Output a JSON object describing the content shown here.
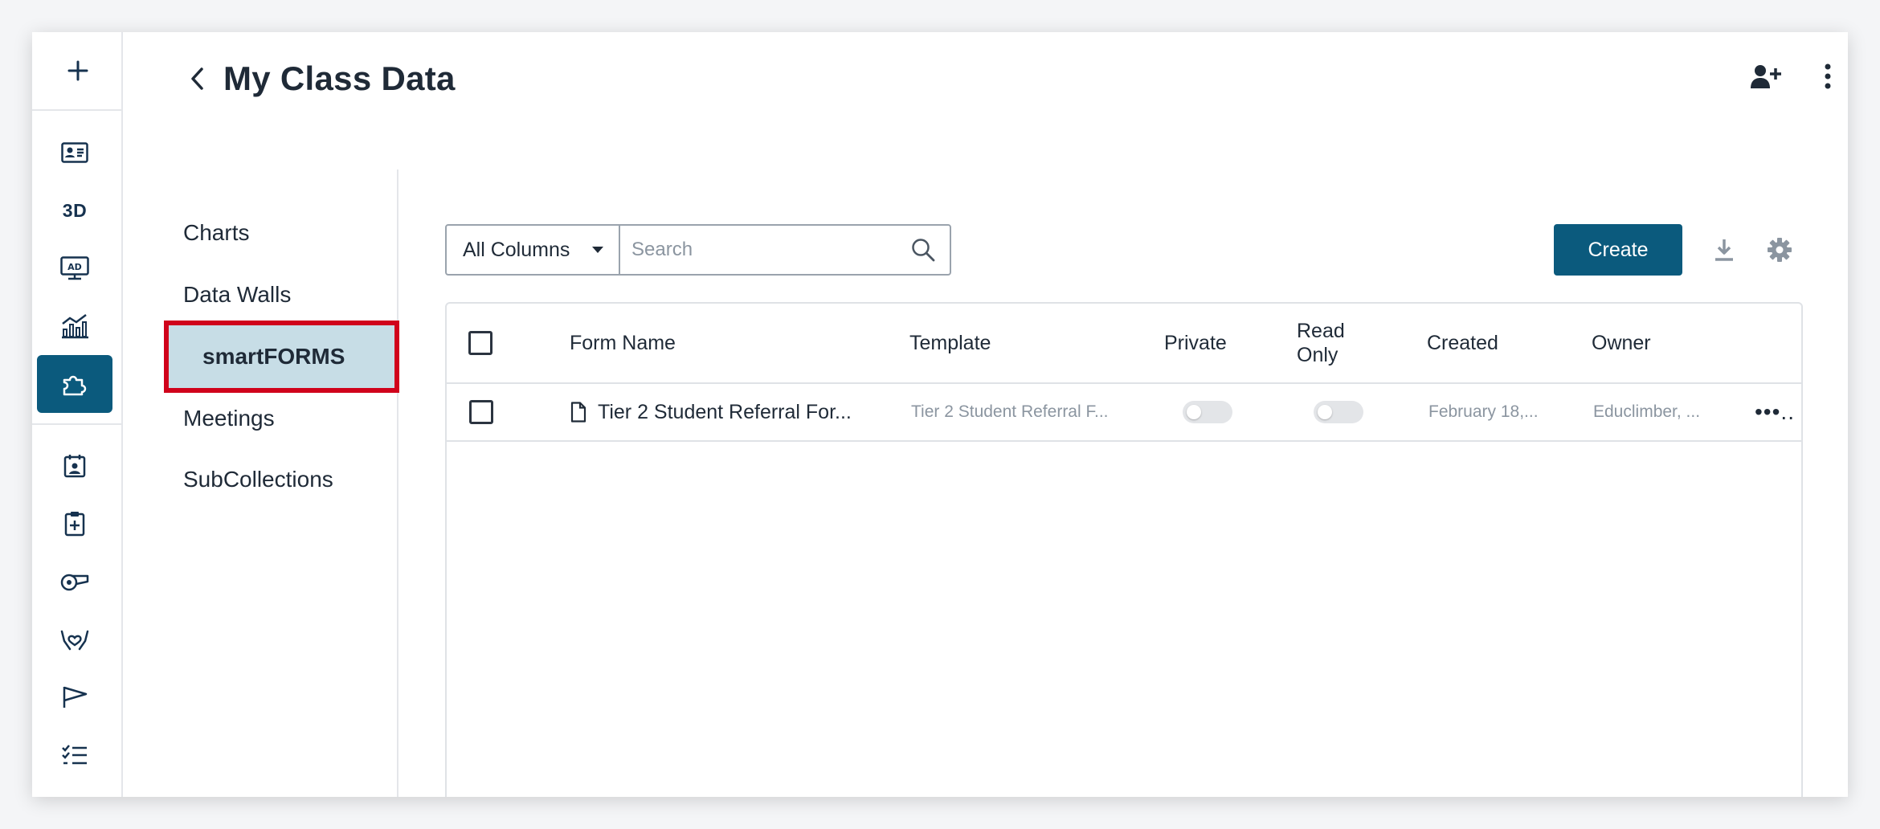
{
  "header": {
    "title": "My Class Data"
  },
  "rail": {
    "items": [
      {
        "icon": "add-icon"
      },
      {
        "icon": "id-card-icon"
      },
      {
        "icon": "3d-icon",
        "label": "3D"
      },
      {
        "icon": "ad-monitor-icon",
        "label": "AD"
      },
      {
        "icon": "chart-icon"
      },
      {
        "icon": "puzzle-icon",
        "active": true
      },
      {
        "icon": "calendar-person-icon"
      },
      {
        "icon": "clipboard-plus-icon"
      },
      {
        "icon": "whistle-icon"
      },
      {
        "icon": "hands-heart-icon"
      },
      {
        "icon": "flag-icon"
      },
      {
        "icon": "checklist-icon"
      }
    ]
  },
  "subnav": {
    "items": [
      {
        "label": "Charts"
      },
      {
        "label": "Data Walls"
      },
      {
        "label": "smartFORMS",
        "selected": true
      },
      {
        "label": "Meetings"
      },
      {
        "label": "SubCollections"
      }
    ]
  },
  "toolbar": {
    "column_filter": "All Columns",
    "search_placeholder": "Search",
    "create_label": "Create"
  },
  "table": {
    "columns": [
      "Form Name",
      "Template",
      "Private",
      "Read Only",
      "Created",
      "Owner"
    ],
    "rows": [
      {
        "form_name": "Tier 2 Student Referral For...",
        "template": "Tier 2 Student Referral F...",
        "private": false,
        "read_only": false,
        "created": "February 18,...",
        "owner": "Educlimber, ...",
        "more": "•••.."
      }
    ]
  },
  "colors": {
    "primary": "#0b5a7d",
    "selected_bg": "#c7dde6",
    "highlight_border": "#d0021b"
  }
}
